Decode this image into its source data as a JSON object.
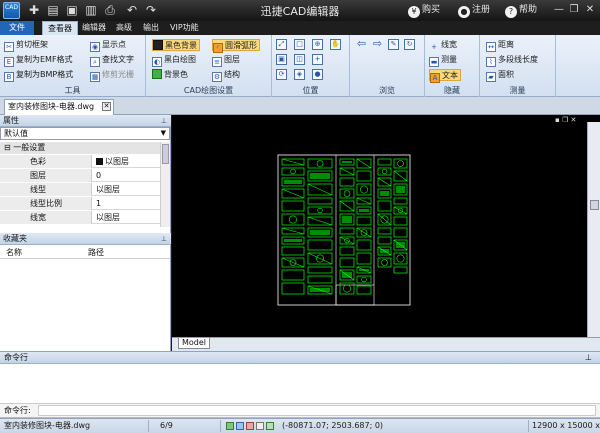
{
  "titlebar": {
    "app_icon_text": "CAD",
    "title": "迅捷CAD编辑器",
    "buy": "购买",
    "register": "注册",
    "help": "帮助",
    "icons": [
      "new-icon",
      "save-icon",
      "save-as-icon",
      "print-icon",
      "undo-icon",
      "redo-icon"
    ]
  },
  "menu": {
    "tabs": [
      "文件",
      "查看器",
      "编辑器",
      "高级",
      "输出",
      "VIP功能"
    ]
  },
  "ribbon": {
    "tools": {
      "label": "工具",
      "items": [
        "剪切框架",
        "复制为EMF格式",
        "复制为BMP格式",
        "显示点",
        "查找文字",
        "修剪光栅"
      ]
    },
    "cad_settings": {
      "label": "CAD绘图设置",
      "items": [
        "黑色背景",
        "黑白绘图",
        "背景色",
        "圆滑弧形",
        "图层",
        "结构"
      ]
    },
    "position": {
      "label": "位置"
    },
    "browse": {
      "label": "浏览"
    },
    "hide": {
      "label": "隐藏",
      "items": [
        "线宽",
        "测量",
        "文本"
      ]
    },
    "measure": {
      "label": "测量",
      "items": [
        "距离",
        "多段线长度",
        "面积"
      ]
    }
  },
  "document": {
    "tab": "室内装修图块-电器.dwg"
  },
  "properties": {
    "title": "属性",
    "selector": "默认值",
    "group": "一般设置",
    "rows": [
      {
        "name": "色彩",
        "value": "以图层"
      },
      {
        "name": "图层",
        "value": "0"
      },
      {
        "name": "线型",
        "value": "以图层"
      },
      {
        "name": "线型比例",
        "value": "1"
      },
      {
        "name": "线宽",
        "value": "以图层"
      }
    ]
  },
  "favorites": {
    "title": "收藏夹",
    "col_name": "名称",
    "col_path": "路径"
  },
  "canvas": {
    "layout_tab": "Model",
    "background": "#000000",
    "drawing_color": "#00ff00"
  },
  "command": {
    "title": "命令行",
    "input_label": "命令行:"
  },
  "status": {
    "file": "室内装修图块-电器.dwg",
    "page": "6/9",
    "coords": "(-80871.07; 2503.687; 0)",
    "size": "12900 x 15000 x 0"
  }
}
